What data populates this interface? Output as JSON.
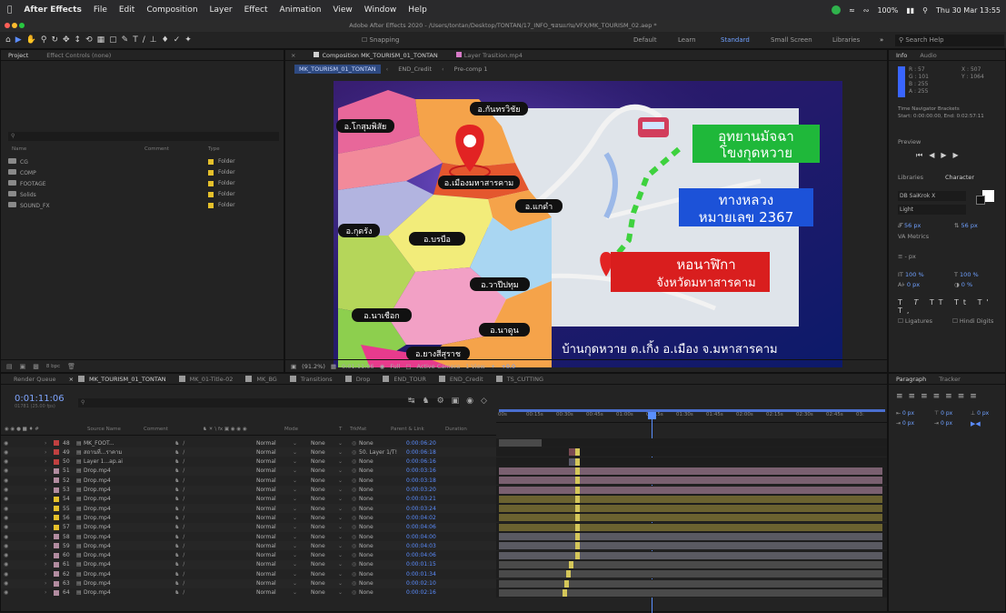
{
  "menubar": {
    "app": "After Effects",
    "items": [
      "File",
      "Edit",
      "Composition",
      "Layer",
      "Effect",
      "Animation",
      "View",
      "Window",
      "Help"
    ],
    "battery": "100%",
    "datetime": "Thu 30 Mar 13:55"
  },
  "titlebar": "Adobe After Effects 2020 - /Users/tontan/Desktop/TONTAN/17_INFO_ขอนแก่น/VFX/MK_TOURISM_02.aep *",
  "toolbar": {
    "snapping": "Snapping",
    "workspaces": [
      "Default",
      "Learn",
      "Standard",
      "Small Screen",
      "Libraries"
    ],
    "active_workspace": "Standard",
    "search": "Search Help"
  },
  "project": {
    "tabs": [
      "Project",
      "Effect Controls (none)"
    ],
    "headers": [
      "Name",
      "Comment",
      "Type"
    ],
    "rows": [
      {
        "name": "CG",
        "type": "Folder"
      },
      {
        "name": "COMP",
        "type": "Folder"
      },
      {
        "name": "FOOTAGE",
        "type": "Folder"
      },
      {
        "name": "Solids",
        "type": "Folder"
      },
      {
        "name": "SOUND_FX",
        "type": "Folder"
      }
    ],
    "bpc": "8 bpc"
  },
  "comp": {
    "tab": "Composition MK_TOURISM_01_TONTAN",
    "tab2": "Layer Trasition.mp4",
    "subtabs": [
      "MK_TOURISM_01_TONTAN",
      "END_Credit",
      "Pre-comp 1"
    ],
    "labels": {
      "kantharawichai": "อ.กันทรวิชัย",
      "kosum": "อ.โกสุมพิสัย",
      "muang": "อ.เมืองมหาสารคาม",
      "kaedam": "อ.แกดำ",
      "kudrang": "อ.กุดรัง",
      "borabue": "อ.บรบือ",
      "wapi": "อ.วาปีปทุม",
      "nachueak": "อ.นาเชือก",
      "nadun": "อ.นาดูน",
      "yangsisurat": "อ.ยางสีสุราช"
    },
    "green_box": [
      "อุทยานมัจฉา",
      "โขงกุดหวาย"
    ],
    "blue_box": [
      "ทางหลวง",
      "หมายเลข 2367"
    ],
    "red_box": [
      "หอนาฬิกา",
      "จังหวัดมหาสารคาม"
    ],
    "footer_caption": "บ้านกุดหวาย ต.เกิ้ง อ.เมือง จ.มหาสารคาม",
    "foot": {
      "zoom": "(91.2%)",
      "time": "0:01:11:06",
      "res": "Full",
      "camera": "Active Camera",
      "view": "1 View",
      "exposure": "+0.0"
    }
  },
  "right": {
    "info_tab": "Info",
    "audio_tab": "Audio",
    "r": "R : 57",
    "g": "G : 101",
    "b": "B : 255",
    "a": "A : 255",
    "x": "X : 507",
    "y": "Y : 1064",
    "nav_title": "Time Navigator Brackets",
    "nav_val": "Start: 0:00:00:00, End: 0:02:57:11",
    "preview": "Preview",
    "libraries": "Libraries",
    "character": "Character",
    "font": "DB SaiKrok X",
    "style": "Light",
    "size": "56 px",
    "leading": "56 px",
    "tracking_label": "Metrics",
    "ligatures": "Ligatures",
    "hindi": "Hindi Digits",
    "vscale": "100 %",
    "hscale": "100 %",
    "baseline": "0 px",
    "tsume": "0 %",
    "px": "- px"
  },
  "timeline": {
    "tabs": [
      {
        "label": "Render Queue",
        "color": ""
      },
      {
        "label": "MK_TOURISM_01_TONTAN",
        "color": "#9a9a9a"
      },
      {
        "label": "MK_01-Title-02",
        "color": "#9a9a9a"
      },
      {
        "label": "MK_BG",
        "color": "#9a9a9a"
      },
      {
        "label": "Transitions",
        "color": "#9a9a9a"
      },
      {
        "label": "Drop",
        "color": "#9a9a9a"
      },
      {
        "label": "END_TOUR",
        "color": "#9a9a9a"
      },
      {
        "label": "END_Credit",
        "color": "#9a9a9a"
      },
      {
        "label": "TS_CUTTING",
        "color": "#9a9a9a"
      }
    ],
    "timecode": "0:01:11:06",
    "fps": "01781 (25.00 fps)",
    "ruler": [
      "00s",
      "00:15s",
      "00:30s",
      "00:45s",
      "01:00s",
      "01:15s",
      "01:30s",
      "01:45s",
      "02:00s",
      "02:15s",
      "02:30s",
      "02:45s",
      "03:"
    ],
    "colheads": [
      "Source Name",
      "Comment",
      "Mode",
      "T",
      "TrkMat",
      "Parent & Link",
      "Duration"
    ],
    "layers": [
      {
        "n": "48",
        "name": "MK_FOOT...",
        "mode": "Normal",
        "trk": "None",
        "parent": "None",
        "dur": "0:00:06:20",
        "color": "#c04040"
      },
      {
        "n": "49",
        "name": "สถานที่...ราคาม",
        "mode": "Normal",
        "trk": "None",
        "parent": "50. Layer 1/T!",
        "dur": "0:00:06:18",
        "color": "#c04040"
      },
      {
        "n": "50",
        "name": "Layer 1...ap.ai",
        "mode": "Normal",
        "trk": "None",
        "parent": "None",
        "dur": "0:00:06:16",
        "color": "#c04040"
      },
      {
        "n": "51",
        "name": "Drop.mp4",
        "mode": "Normal",
        "trk": "None",
        "parent": "None",
        "dur": "0:00:03:16",
        "color": "#b28ca0"
      },
      {
        "n": "52",
        "name": "Drop.mp4",
        "mode": "Normal",
        "trk": "None",
        "parent": "None",
        "dur": "0:00:03:18",
        "color": "#b28ca0"
      },
      {
        "n": "53",
        "name": "Drop.mp4",
        "mode": "Normal",
        "trk": "None",
        "parent": "None",
        "dur": "0:00:03:20",
        "color": "#b28ca0"
      },
      {
        "n": "54",
        "name": "Drop.mp4",
        "mode": "Normal",
        "trk": "None",
        "parent": "None",
        "dur": "0:00:03:21",
        "color": "#e5c02b"
      },
      {
        "n": "55",
        "name": "Drop.mp4",
        "mode": "Normal",
        "trk": "None",
        "parent": "None",
        "dur": "0:00:03:24",
        "color": "#e5c02b"
      },
      {
        "n": "56",
        "name": "Drop.mp4",
        "mode": "Normal",
        "trk": "None",
        "parent": "None",
        "dur": "0:00:04:02",
        "color": "#e5c02b"
      },
      {
        "n": "57",
        "name": "Drop.mp4",
        "mode": "Normal",
        "trk": "None",
        "parent": "None",
        "dur": "0:00:04:06",
        "color": "#e5c02b"
      },
      {
        "n": "58",
        "name": "Drop.mp4",
        "mode": "Normal",
        "trk": "None",
        "parent": "None",
        "dur": "0:00:04:00",
        "color": "#b28ca0"
      },
      {
        "n": "59",
        "name": "Drop.mp4",
        "mode": "Normal",
        "trk": "None",
        "parent": "None",
        "dur": "0:00:04:03",
        "color": "#b28ca0"
      },
      {
        "n": "60",
        "name": "Drop.mp4",
        "mode": "Normal",
        "trk": "None",
        "parent": "None",
        "dur": "0:00:04:06",
        "color": "#b28ca0"
      },
      {
        "n": "61",
        "name": "Drop.mp4",
        "mode": "Normal",
        "trk": "None",
        "parent": "None",
        "dur": "0:00:01:15",
        "color": "#b28ca0"
      },
      {
        "n": "62",
        "name": "Drop.mp4",
        "mode": "Normal",
        "trk": "None",
        "parent": "None",
        "dur": "0:00:01:34",
        "color": "#b28ca0"
      },
      {
        "n": "63",
        "name": "Drop.mp4",
        "mode": "Normal",
        "trk": "None",
        "parent": "None",
        "dur": "0:00:02:10",
        "color": "#b28ca0"
      },
      {
        "n": "64",
        "name": "Drop.mp4",
        "mode": "Normal",
        "trk": "None",
        "parent": "None",
        "dur": "0:00:02:16",
        "color": "#b28ca0"
      }
    ]
  },
  "paragraph": {
    "tab": "Paragraph",
    "tab2": "Tracker",
    "v": "0 px"
  }
}
